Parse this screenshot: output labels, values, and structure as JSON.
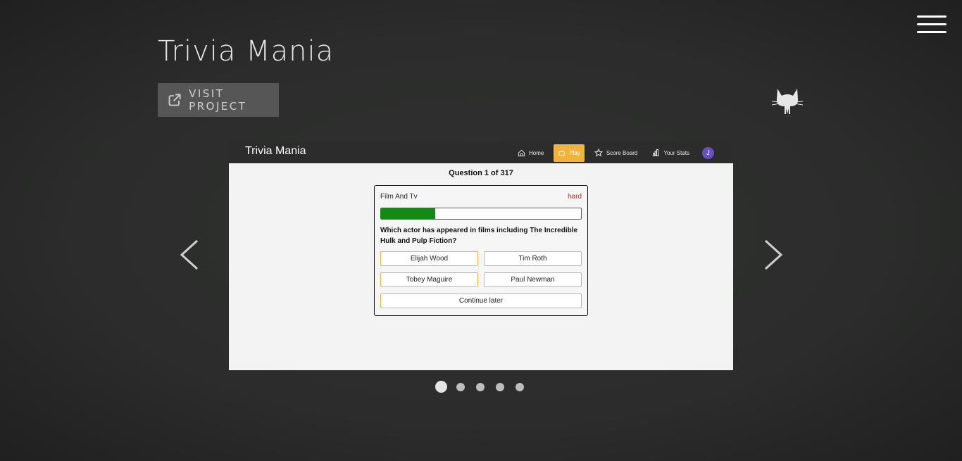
{
  "page": {
    "title": "Trivia Mania",
    "visit_label": "VISIT PROJECT",
    "menu_icon": "hamburger-icon",
    "github_icon": "github-octocat-icon",
    "prev_icon": "chevron-left-icon",
    "next_icon": "chevron-right-icon"
  },
  "app": {
    "title": "Trivia Mania",
    "nav": [
      {
        "label": "Home",
        "icon": "home-icon"
      },
      {
        "label": "Play",
        "icon": "puzzle-icon",
        "active": true
      },
      {
        "label": "Score Board",
        "icon": "star-icon"
      },
      {
        "label": "Your Stats",
        "icon": "bar-chart-icon"
      }
    ],
    "avatar_letter": "J",
    "accent": "#f2b33d"
  },
  "quiz": {
    "header": "Question 1 of 317",
    "category": "Film And Tv",
    "difficulty": "hard",
    "difficulty_color": "#dd2222",
    "progress_fraction": 0.27,
    "question": "Which actor has appeared in films including The Incredible Hulk and Pulp Fiction?",
    "answers": [
      "Elijah Wood",
      "Tim Roth",
      "Tobey Maguire",
      "Paul Newman"
    ],
    "continue_label": "Continue later"
  },
  "carousel": {
    "slide_count": 5,
    "active_index": 0
  }
}
